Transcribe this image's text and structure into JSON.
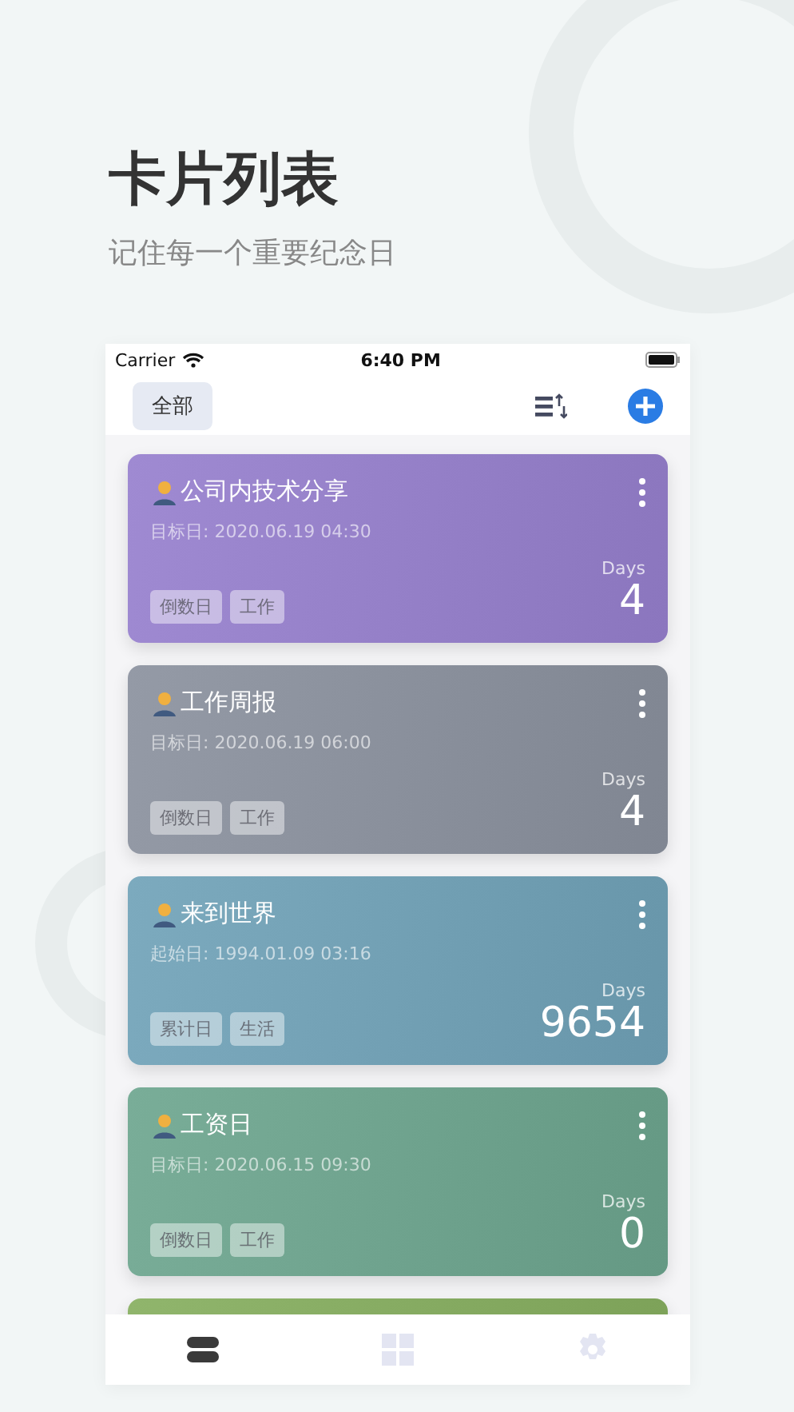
{
  "header": {
    "title": "卡片列表",
    "subtitle": "记住每一个重要纪念日"
  },
  "status_bar": {
    "carrier": "Carrier",
    "time": "6:40 PM"
  },
  "toolbar": {
    "filter": "全部"
  },
  "cards": [
    {
      "title": "公司内技术分享",
      "date": "目标日: 2020.06.19 04:30",
      "tags": [
        "倒数日",
        "工作"
      ],
      "unit": "Days",
      "count": "4",
      "color": "#9580c8"
    },
    {
      "title": "工作周报",
      "date": "目标日: 2020.06.19 06:00",
      "tags": [
        "倒数日",
        "工作"
      ],
      "unit": "Days",
      "count": "4",
      "color": "#8a909c"
    },
    {
      "title": "来到世界",
      "date": "起始日: 1994.01.09 03:16",
      "tags": [
        "累计日",
        "生活"
      ],
      "unit": "Days",
      "count": "9654",
      "color": "#72a0b4"
    },
    {
      "title": "工资日",
      "date": "目标日: 2020.06.15 09:30",
      "tags": [
        "倒数日",
        "工作"
      ],
      "unit": "Days",
      "count": "0",
      "color": "#6fa38e"
    },
    {
      "color": "#86ab62"
    }
  ],
  "tabs": [
    {
      "kind": "list",
      "selected": true
    },
    {
      "kind": "grid",
      "selected": false
    },
    {
      "kind": "settings",
      "selected": false
    }
  ]
}
